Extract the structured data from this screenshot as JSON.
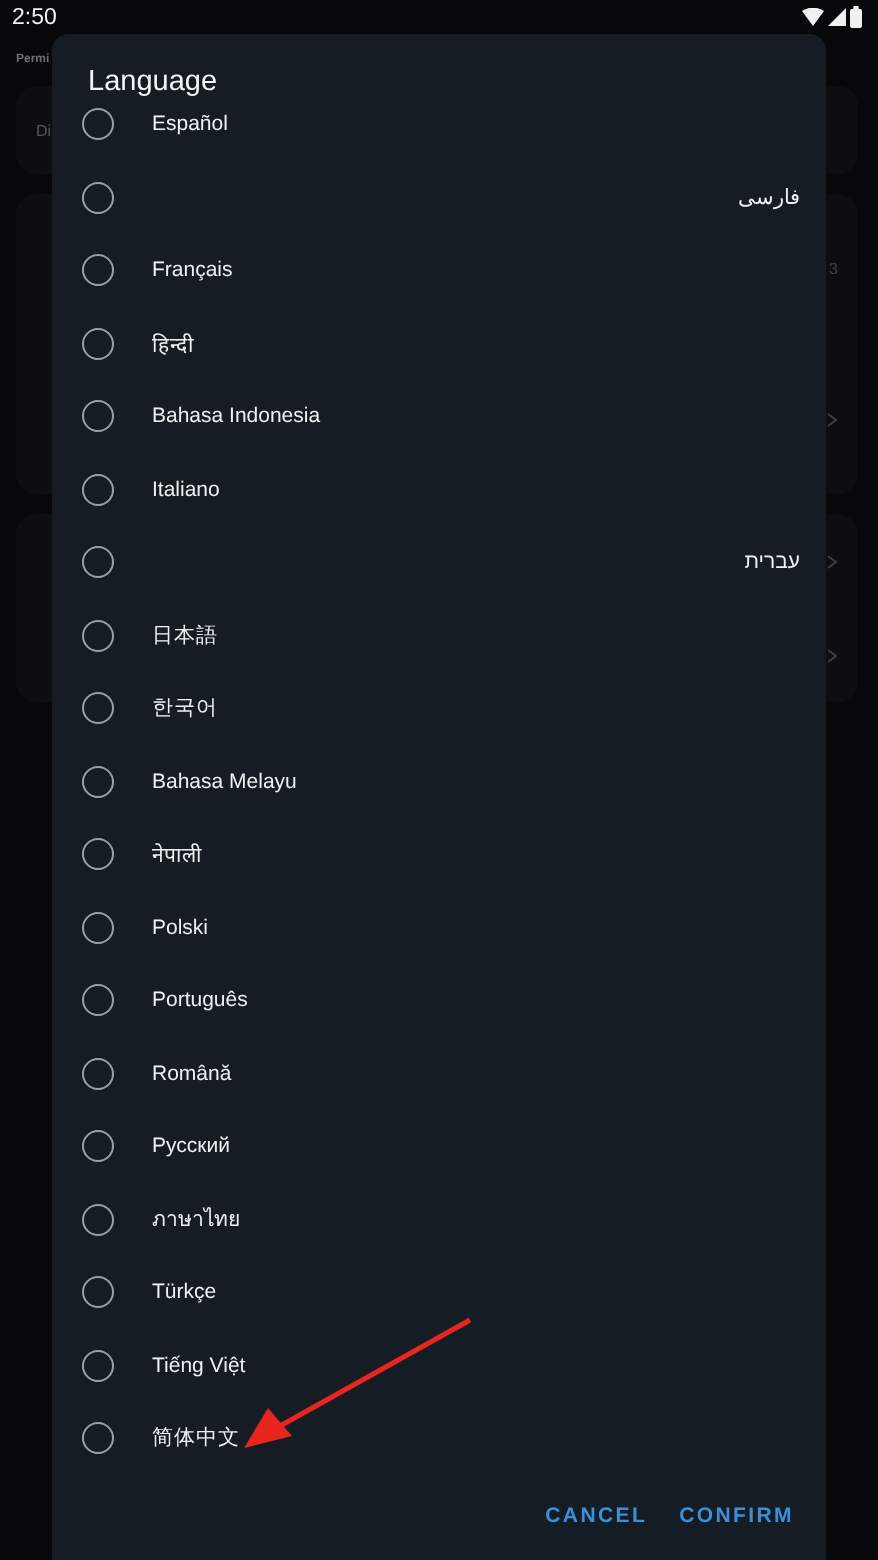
{
  "status_bar": {
    "time": "2:50"
  },
  "background": {
    "section_label": "Permi",
    "card_row": "Di",
    "row_value": "3"
  },
  "dialog": {
    "title": "Language",
    "options": [
      {
        "label": "Español",
        "selected": false,
        "kind": "ltr"
      },
      {
        "label": "فارسی",
        "selected": false,
        "kind": "rtl"
      },
      {
        "label": "Français",
        "selected": false,
        "kind": "ltr"
      },
      {
        "label": "हिन्दी",
        "selected": false,
        "kind": "ltr"
      },
      {
        "label": "Bahasa Indonesia",
        "selected": false,
        "kind": "ltr"
      },
      {
        "label": "Italiano",
        "selected": false,
        "kind": "ltr"
      },
      {
        "label": "עברית",
        "selected": false,
        "kind": "rtl"
      },
      {
        "label": "日本語",
        "selected": false,
        "kind": "ltr"
      },
      {
        "label": "한국어",
        "selected": false,
        "kind": "ltr"
      },
      {
        "label": "Bahasa Melayu",
        "selected": false,
        "kind": "ltr"
      },
      {
        "label": "नेपाली",
        "selected": false,
        "kind": "ltr"
      },
      {
        "label": "Polski",
        "selected": false,
        "kind": "ltr"
      },
      {
        "label": "Português",
        "selected": false,
        "kind": "ltr"
      },
      {
        "label": "Română",
        "selected": false,
        "kind": "ltr"
      },
      {
        "label": "Русский",
        "selected": false,
        "kind": "ltr"
      },
      {
        "label": "ภาษาไทย",
        "selected": false,
        "kind": "ltr"
      },
      {
        "label": "Türkçe",
        "selected": false,
        "kind": "ltr"
      },
      {
        "label": "Tiếng Việt",
        "selected": false,
        "kind": "ltr"
      },
      {
        "label": "简体中文",
        "selected": false,
        "kind": "ltr"
      }
    ],
    "buttons": [
      "CANCEL",
      "CONFIRM"
    ]
  }
}
